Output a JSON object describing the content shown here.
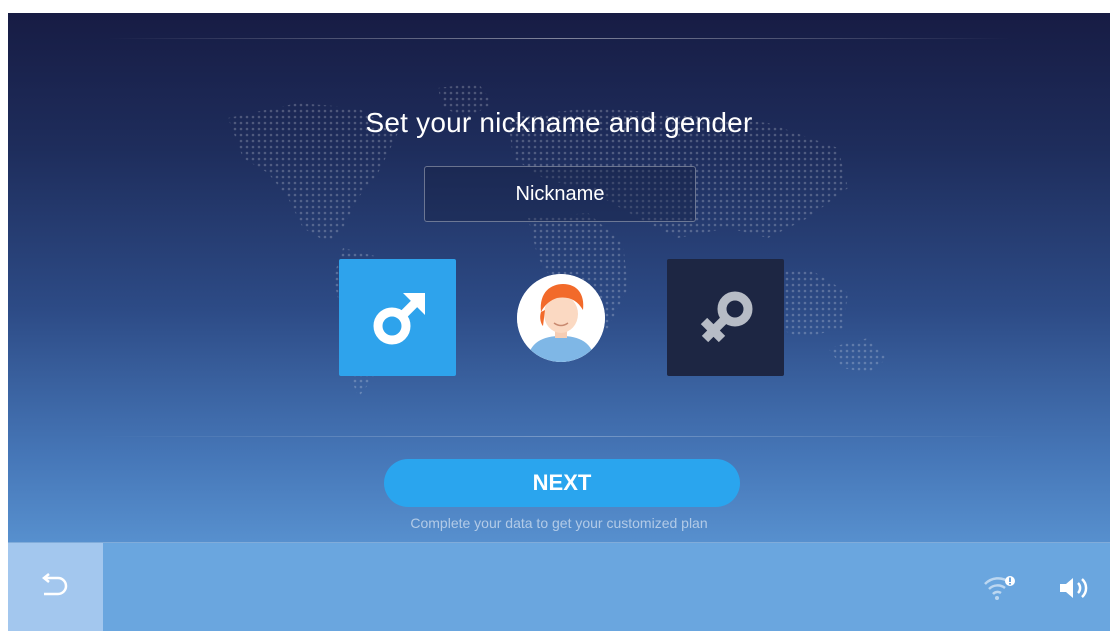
{
  "screen": {
    "title": "Set your nickname and gender"
  },
  "nickname_field": {
    "placeholder": "Nickname"
  },
  "gender": {
    "selected": "male",
    "male_color": "#2ea3ec",
    "female_color": "#1d2643"
  },
  "actions": {
    "next_label": "NEXT",
    "hint": "Complete your data to get your customized plan"
  },
  "bottom_bar": {
    "back_icon": "back-arrow-icon",
    "status_icons": [
      "wifi-warning-icon",
      "volume-icon"
    ]
  }
}
